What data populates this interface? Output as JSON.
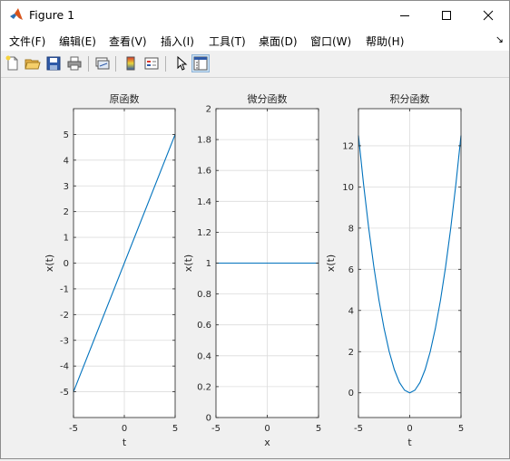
{
  "window": {
    "title": "Figure 1",
    "icon": "matlab-icon",
    "controls": [
      "minimize-icon",
      "maximize-icon",
      "close-icon"
    ]
  },
  "menubar": {
    "items": [
      {
        "label": "文件(F)"
      },
      {
        "label": "编辑(E)"
      },
      {
        "label": "查看(V)"
      },
      {
        "label": "插入(I)"
      },
      {
        "label": "工具(T)"
      },
      {
        "label": "桌面(D)"
      },
      {
        "label": "窗口(W)"
      },
      {
        "label": "帮助(H)"
      }
    ],
    "overflow_icon": "menu-overflow-icon"
  },
  "toolbar": {
    "buttons": [
      "new-figure-icon",
      "open-file-icon",
      "save-icon",
      "print-icon",
      "link-plot-icon",
      "insert-colorbar-icon",
      "insert-legend-icon",
      "edit-plot-icon",
      "property-inspector-icon"
    ]
  },
  "colors": {
    "line": "#0072bd",
    "grid": "#dcdcdc",
    "axes_bg": "#ffffff",
    "fig_bg": "#f0f0f0"
  },
  "chart_data": [
    {
      "type": "line",
      "title": "原函数",
      "xlabel": "t",
      "ylabel": "x(t)",
      "xlim": [
        -5,
        5
      ],
      "ylim": [
        -6,
        6
      ],
      "xticks": [
        -5,
        0,
        5
      ],
      "yticks": [
        -5,
        -4,
        -3,
        -2,
        -1,
        0,
        1,
        2,
        3,
        4,
        5
      ],
      "grid": true,
      "series": [
        {
          "x": [
            -5,
            5
          ],
          "y": [
            -5,
            5
          ]
        }
      ]
    },
    {
      "type": "line",
      "title": "微分函数",
      "xlabel": "x",
      "ylabel": "x(t)",
      "xlim": [
        -5,
        5
      ],
      "ylim": [
        0,
        2
      ],
      "xticks": [
        -5,
        0,
        5
      ],
      "yticks": [
        0,
        0.2,
        0.4,
        0.6,
        0.8,
        1,
        1.2,
        1.4,
        1.6,
        1.8,
        2
      ],
      "grid": true,
      "series": [
        {
          "x": [
            -5,
            5
          ],
          "y": [
            1,
            1
          ]
        }
      ]
    },
    {
      "type": "line",
      "title": "积分函数",
      "xlabel": "t",
      "ylabel": "x(t)",
      "xlim": [
        -5,
        5
      ],
      "ylim": [
        -1.2,
        13.8
      ],
      "xticks": [
        -5,
        0,
        5
      ],
      "yticks": [
        0,
        2,
        4,
        6,
        8,
        10,
        12
      ],
      "grid": true,
      "series": [
        {
          "x": [
            -5,
            -4.5,
            -4,
            -3.5,
            -3,
            -2.5,
            -2,
            -1.5,
            -1,
            -0.5,
            0,
            0.5,
            1,
            1.5,
            2,
            2.5,
            3,
            3.5,
            4,
            4.5,
            5
          ],
          "y": [
            12.5,
            10.125,
            8,
            6.125,
            4.5,
            3.125,
            2,
            1.125,
            0.5,
            0.125,
            0,
            0.125,
            0.5,
            1.125,
            2,
            3.125,
            4.5,
            6.125,
            8,
            10.125,
            12.5
          ]
        }
      ]
    }
  ]
}
